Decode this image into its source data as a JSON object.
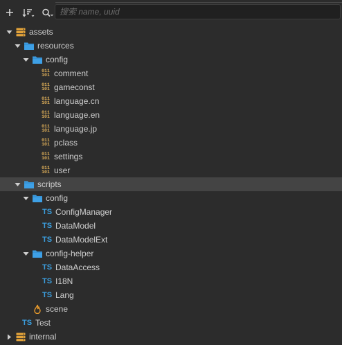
{
  "search": {
    "placeholder": "搜索 name, uuid"
  },
  "toolbar": {
    "buttons": [
      "add-icon",
      "sort-icon",
      "search-filter-icon"
    ]
  },
  "colors": {
    "background": "#2c2c2c",
    "selected_row": "#444444",
    "folder": "#3ea0e6",
    "db": "#e3a33a",
    "json": "#e3b25a",
    "ts": "#3b9ede",
    "scene": "#e89a2c"
  },
  "tree": [
    {
      "label": "assets",
      "type": "db",
      "expanded": true,
      "depth": 0,
      "selected": false
    },
    {
      "label": "resources",
      "type": "folder",
      "expanded": true,
      "depth": 1,
      "selected": false
    },
    {
      "label": "config",
      "type": "folder",
      "expanded": true,
      "depth": 2,
      "selected": false
    },
    {
      "label": "comment",
      "type": "json",
      "depth": 3,
      "selected": false
    },
    {
      "label": "gameconst",
      "type": "json",
      "depth": 3,
      "selected": false
    },
    {
      "label": "language.cn",
      "type": "json",
      "depth": 3,
      "selected": false
    },
    {
      "label": "language.en",
      "type": "json",
      "depth": 3,
      "selected": false
    },
    {
      "label": "language.jp",
      "type": "json",
      "depth": 3,
      "selected": false
    },
    {
      "label": "pclass",
      "type": "json",
      "depth": 3,
      "selected": false
    },
    {
      "label": "settings",
      "type": "json",
      "depth": 3,
      "selected": false
    },
    {
      "label": "user",
      "type": "json",
      "depth": 3,
      "selected": false
    },
    {
      "label": "scripts",
      "type": "folder",
      "expanded": true,
      "depth": 1,
      "selected": true
    },
    {
      "label": "config",
      "type": "folder",
      "expanded": true,
      "depth": 2,
      "selected": false
    },
    {
      "label": "ConfigManager",
      "type": "ts",
      "depth": 3,
      "selected": false
    },
    {
      "label": "DataModel",
      "type": "ts",
      "depth": 3,
      "selected": false
    },
    {
      "label": "DataModelExt",
      "type": "ts",
      "depth": 3,
      "selected": false
    },
    {
      "label": "config-helper",
      "type": "folder",
      "expanded": true,
      "depth": 2,
      "selected": false
    },
    {
      "label": "DataAccess",
      "type": "ts",
      "depth": 3,
      "selected": false
    },
    {
      "label": "I18N",
      "type": "ts",
      "depth": 3,
      "selected": false
    },
    {
      "label": "Lang",
      "type": "ts",
      "depth": 3,
      "selected": false
    },
    {
      "label": "scene",
      "type": "scene",
      "depth": 2,
      "selected": false
    },
    {
      "label": "Test",
      "type": "ts",
      "depth": 2,
      "selected": false
    },
    {
      "label": "internal",
      "type": "db",
      "expanded": false,
      "depth": 0,
      "selected": false
    }
  ]
}
